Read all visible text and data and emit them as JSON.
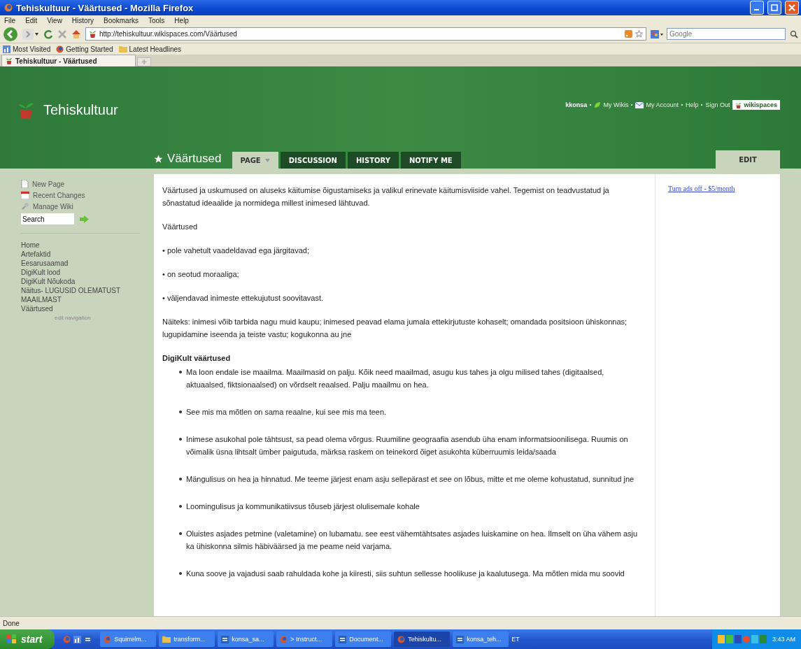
{
  "window": {
    "title": "Tehiskultuur - Väärtused - Mozilla Firefox"
  },
  "menu": [
    "File",
    "Edit",
    "View",
    "History",
    "Bookmarks",
    "Tools",
    "Help"
  ],
  "toolbar": {
    "url": "http://tehiskultuur.wikispaces.com/Väärtused",
    "search_placeholder": "Google"
  },
  "bookmarks": [
    {
      "label": "Most Visited",
      "kind": "chart"
    },
    {
      "label": "Getting Started",
      "kind": "firefox"
    },
    {
      "label": "Latest Headlines",
      "kind": "folder"
    }
  ],
  "browser_tabs": [
    {
      "label": "Tehiskultuur - Väärtused",
      "selected": true
    }
  ],
  "wiki": {
    "name": "Tehiskultuur",
    "user_links": [
      {
        "label": "kkonsa",
        "kind": "user"
      },
      {
        "label": "My Wikis",
        "kind": "leaf"
      },
      {
        "label": "My Account",
        "kind": "mail"
      },
      {
        "label": "Help",
        "kind": "plain"
      },
      {
        "label": "Sign Out",
        "kind": "plain"
      }
    ],
    "brand": "wikispaces",
    "page_title": "Väärtused"
  },
  "page_tabs": [
    {
      "label": "PAGE",
      "selected": true
    },
    {
      "label": "DISCUSSION",
      "selected": false
    },
    {
      "label": "HISTORY",
      "selected": false
    },
    {
      "label": "NOTIFY ME",
      "selected": false
    }
  ],
  "edit_tab": "EDIT",
  "sidebar": {
    "actions": [
      {
        "label": "New Page",
        "kind": "page"
      },
      {
        "label": "Recent Changes",
        "kind": "calendar"
      },
      {
        "label": "Manage Wiki",
        "kind": "wrench"
      }
    ],
    "search": {
      "value": "Search"
    },
    "nav": [
      "Home",
      "Artefaktid",
      "Eesarusaamad",
      "DigiKult lood",
      "DigiKult Nõukoda",
      "Näitus- LUGUSID OLEMATUST MAAILMAST",
      "Väärtused"
    ],
    "edit_nav": "edit navigation"
  },
  "content": [
    {
      "kind": "paragraph",
      "text": "Väärtused ja uskumused on aluseks käitumise õigustamiseks ja valikul erinevate käitumisviiside vahel. Tegemist on teadvustatud ja sõnastatud ideaalide ja normidega millest inimesed lähtuvad."
    },
    {
      "kind": "paragraph",
      "text": "Väärtused"
    },
    {
      "kind": "paragraph",
      "text": "• pole vahetult vaadeldavad ega järgitavad;"
    },
    {
      "kind": "paragraph",
      "text": "• on seotud moraaliga;"
    },
    {
      "kind": "paragraph",
      "text": "• väljendavad inimeste ettekujutust soovitavast."
    },
    {
      "kind": "paragraph",
      "text": "Näiteks: inimesi võib tarbida nagu muid kaupu; inimesed peavad elama jumala ettekirjutuste kohaselt; omandada positsioon ühiskonnas; lugupidamine iseenda ja teiste vastu; kogukonna au jne"
    },
    {
      "kind": "heading",
      "text": "DigiKult väärtused"
    },
    {
      "kind": "list",
      "items": [
        "Ma loon endale ise maailma. Maailmasid on palju. Kõik need maailmad, asugu kus tahes ja olgu milised tahes (digitaalsed, aktuaalsed, fiktsionaalsed) on võrdselt reaalsed. Palju maailmu on hea.",
        "See mis ma mõtlen on sama reaalne, kui see mis ma teen.",
        "Inimese asukohal pole tähtsust, sa pead olema võrgus. Ruumiline geograafia asendub üha enam informatsioonilisega. Ruumis on võimalik üsna lihtsalt ümber paigutuda, märksa raskem on teinekord õiget asukohta küberruumis leida/saada",
        "Mängulisus on hea ja hinnatud. Me teeme järjest enam asju sellepärast et see on lõbus, mitte et me oleme kohustatud, sunnitud jne",
        "Loomingulisus ja kommunikatiivsus tõuseb järjest olulisemale kohale",
        "Oluistes asjades petmine (valetamine) on lubamatu. see eest vähemtähtsates asjades luiskamine on hea. Ilmselt on üha vähem asju ka ühiskonna silmis häbiväärsed ja me peame neid varjama.",
        "Kuna soove ja vajadusi saab rahuldada kohe ja kiiresti, siis suhtun sellesse hoolikuse ja kaalutusega. Ma mõtlen mida mu soovid"
      ]
    }
  ],
  "ad": "Turn ads off - $5/month",
  "status": "Done",
  "taskbar": {
    "start": "start",
    "tasks": [
      {
        "label": "Squirrelm...",
        "kind": "firefox",
        "selected": false
      },
      {
        "label": "transform...",
        "kind": "folder",
        "selected": false
      },
      {
        "label": "konsa_sa...",
        "kind": "word",
        "selected": false
      },
      {
        "label": "> Instruct...",
        "kind": "firefox",
        "selected": false
      },
      {
        "label": "Document...",
        "kind": "word",
        "selected": false
      },
      {
        "label": "Tehiskultu...",
        "kind": "firefox",
        "selected": true
      },
      {
        "label": "konsa_teh...",
        "kind": "word",
        "selected": false
      }
    ],
    "language": "ET",
    "clock": "3:43 AM"
  }
}
